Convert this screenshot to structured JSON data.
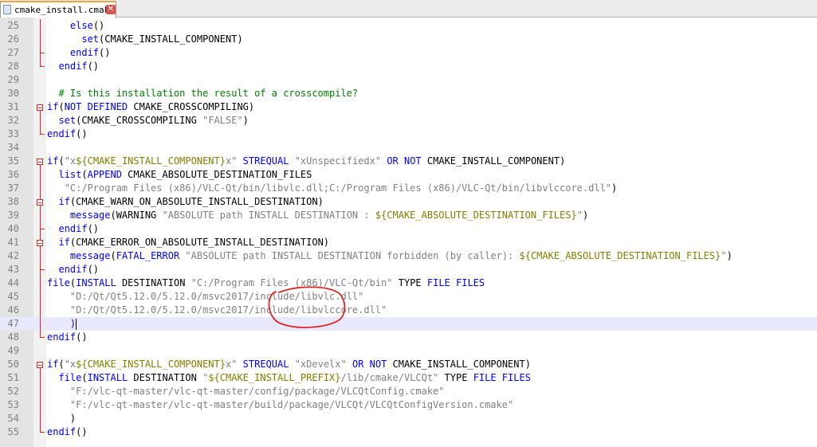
{
  "tab": {
    "label": "cmake_install.cmake",
    "close_icon": "close-icon",
    "file_icon": "file-icon"
  },
  "lines": [
    {
      "num": "25",
      "parts": [
        [
          "",
          "    "
        ],
        [
          "kw",
          "else"
        ],
        [
          "",
          "()"
        ]
      ]
    },
    {
      "num": "26",
      "parts": [
        [
          "",
          "      "
        ],
        [
          "kw",
          "set"
        ],
        [
          "",
          "(CMAKE_INSTALL_COMPONENT)"
        ]
      ]
    },
    {
      "num": "27",
      "parts": [
        [
          "",
          "    "
        ],
        [
          "kw",
          "endif"
        ],
        [
          "",
          "()"
        ]
      ]
    },
    {
      "num": "28",
      "parts": [
        [
          "",
          "  "
        ],
        [
          "kw",
          "endif"
        ],
        [
          "",
          "()"
        ]
      ]
    },
    {
      "num": "29",
      "parts": []
    },
    {
      "num": "30",
      "parts": [
        [
          "cm",
          "  # Is this installation the result of a crosscompile?"
        ]
      ]
    },
    {
      "num": "31",
      "parts": [
        [
          "kw",
          "if"
        ],
        [
          "",
          "("
        ],
        [
          "kw",
          "NOT DEFINED"
        ],
        [
          "",
          " CMAKE_CROSSCOMPILING)"
        ]
      ]
    },
    {
      "num": "32",
      "parts": [
        [
          "",
          "  "
        ],
        [
          "kw",
          "set"
        ],
        [
          "",
          "(CMAKE_CROSSCOMPILING "
        ],
        [
          "st",
          "\"FALSE\""
        ],
        [
          "",
          ")"
        ]
      ]
    },
    {
      "num": "33",
      "parts": [
        [
          "kw",
          "endif"
        ],
        [
          "",
          "()"
        ]
      ]
    },
    {
      "num": "34",
      "parts": []
    },
    {
      "num": "35",
      "parts": [
        [
          "kw",
          "if"
        ],
        [
          "",
          "("
        ],
        [
          "st",
          "\"x"
        ],
        [
          "vr",
          "${CMAKE_INSTALL_COMPONENT}"
        ],
        [
          "st",
          "x\""
        ],
        [
          "",
          " "
        ],
        [
          "kw",
          "STREQUAL"
        ],
        [
          "",
          " "
        ],
        [
          "st",
          "\"xUnspecifiedx\""
        ],
        [
          "",
          " "
        ],
        [
          "kw",
          "OR NOT"
        ],
        [
          "",
          " CMAKE_INSTALL_COMPONENT)"
        ]
      ]
    },
    {
      "num": "36",
      "parts": [
        [
          "",
          "  "
        ],
        [
          "kw",
          "list"
        ],
        [
          "",
          "("
        ],
        [
          "kw",
          "APPEND"
        ],
        [
          "",
          " CMAKE_ABSOLUTE_DESTINATION_FILES"
        ]
      ]
    },
    {
      "num": "37",
      "parts": [
        [
          "",
          "   "
        ],
        [
          "st",
          "\"C:/Program Files (x86)/VLC-Qt/bin/libvlc.dll;C:/Program Files (x86)/VLC-Qt/bin/libvlccore.dll\""
        ],
        [
          "",
          ")"
        ]
      ]
    },
    {
      "num": "38",
      "parts": [
        [
          "",
          "  "
        ],
        [
          "kw",
          "if"
        ],
        [
          "",
          "(CMAKE_WARN_ON_ABSOLUTE_INSTALL_DESTINATION)"
        ]
      ]
    },
    {
      "num": "39",
      "parts": [
        [
          "",
          "    "
        ],
        [
          "kw",
          "message"
        ],
        [
          "",
          "(WARNING "
        ],
        [
          "st",
          "\"ABSOLUTE path INSTALL DESTINATION : "
        ],
        [
          "vr",
          "${CMAKE_ABSOLUTE_DESTINATION_FILES}"
        ],
        [
          "st",
          "\""
        ],
        [
          "",
          ")"
        ]
      ]
    },
    {
      "num": "40",
      "parts": [
        [
          "",
          "  "
        ],
        [
          "kw",
          "endif"
        ],
        [
          "",
          "()"
        ]
      ]
    },
    {
      "num": "41",
      "parts": [
        [
          "",
          "  "
        ],
        [
          "kw",
          "if"
        ],
        [
          "",
          "(CMAKE_ERROR_ON_ABSOLUTE_INSTALL_DESTINATION)"
        ]
      ]
    },
    {
      "num": "42",
      "parts": [
        [
          "",
          "    "
        ],
        [
          "kw",
          "message"
        ],
        [
          "",
          "("
        ],
        [
          "kw",
          "FATAL_ERROR"
        ],
        [
          "",
          " "
        ],
        [
          "st",
          "\"ABSOLUTE path INSTALL DESTINATION forbidden (by caller): "
        ],
        [
          "vr",
          "${CMAKE_ABSOLUTE_DESTINATION_FILES}"
        ],
        [
          "st",
          "\""
        ],
        [
          "",
          ")"
        ]
      ]
    },
    {
      "num": "43",
      "parts": [
        [
          "",
          "  "
        ],
        [
          "kw",
          "endif"
        ],
        [
          "",
          "()"
        ]
      ]
    },
    {
      "num": "44",
      "parts": [
        [
          "kw",
          "file"
        ],
        [
          "",
          "("
        ],
        [
          "kw",
          "INSTALL"
        ],
        [
          "",
          " DESTINATION "
        ],
        [
          "st",
          "\"C:/Program Files (x86)/VLC-Qt/bin\""
        ],
        [
          "",
          " TYPE "
        ],
        [
          "kw",
          "FILE FILES"
        ]
      ]
    },
    {
      "num": "45",
      "parts": [
        [
          "",
          "    "
        ],
        [
          "st",
          "\"D:/Qt/Qt5.12.0/5.12.0/msvc2017/include/libvlc.dll\""
        ]
      ]
    },
    {
      "num": "46",
      "parts": [
        [
          "",
          "    "
        ],
        [
          "st",
          "\"D:/Qt/Qt5.12.0/5.12.0/msvc2017/include/libvlccore.dll\""
        ]
      ]
    },
    {
      "num": "47",
      "parts": [
        [
          "",
          "    "
        ],
        [
          "kw",
          ")"
        ]
      ],
      "current": true
    },
    {
      "num": "48",
      "parts": [
        [
          "kw",
          "endif"
        ],
        [
          "",
          "()"
        ]
      ]
    },
    {
      "num": "49",
      "parts": []
    },
    {
      "num": "50",
      "parts": [
        [
          "kw",
          "if"
        ],
        [
          "",
          "("
        ],
        [
          "st",
          "\"x"
        ],
        [
          "vr",
          "${CMAKE_INSTALL_COMPONENT}"
        ],
        [
          "st",
          "x\""
        ],
        [
          "",
          " "
        ],
        [
          "kw",
          "STREQUAL"
        ],
        [
          "",
          " "
        ],
        [
          "st",
          "\"xDevelx\""
        ],
        [
          "",
          " "
        ],
        [
          "kw",
          "OR NOT"
        ],
        [
          "",
          " CMAKE_INSTALL_COMPONENT)"
        ]
      ]
    },
    {
      "num": "51",
      "parts": [
        [
          "",
          "  "
        ],
        [
          "kw",
          "file"
        ],
        [
          "",
          "("
        ],
        [
          "kw",
          "INSTALL"
        ],
        [
          "",
          " DESTINATION "
        ],
        [
          "st",
          "\""
        ],
        [
          "vr",
          "${CMAKE_INSTALL_PREFIX}"
        ],
        [
          "st",
          "/lib/cmake/VLCQt\""
        ],
        [
          "",
          " TYPE "
        ],
        [
          "kw",
          "FILE FILES"
        ]
      ]
    },
    {
      "num": "52",
      "parts": [
        [
          "",
          "    "
        ],
        [
          "st",
          "\"F:/vlc-qt-master/vlc-qt-master/config/package/VLCQtConfig.cmake\""
        ]
      ]
    },
    {
      "num": "53",
      "parts": [
        [
          "",
          "    "
        ],
        [
          "st",
          "\"F:/vlc-qt-master/vlc-qt-master/build/package/VLCQt/VLCQtConfigVersion.cmake\""
        ]
      ]
    },
    {
      "num": "54",
      "parts": [
        [
          "",
          "    )"
        ]
      ]
    },
    {
      "num": "55",
      "parts": [
        [
          "kw",
          "endif"
        ],
        [
          "",
          "()"
        ]
      ]
    }
  ],
  "highlight": {
    "color": "#dc2626",
    "annotation": "red-circle"
  }
}
